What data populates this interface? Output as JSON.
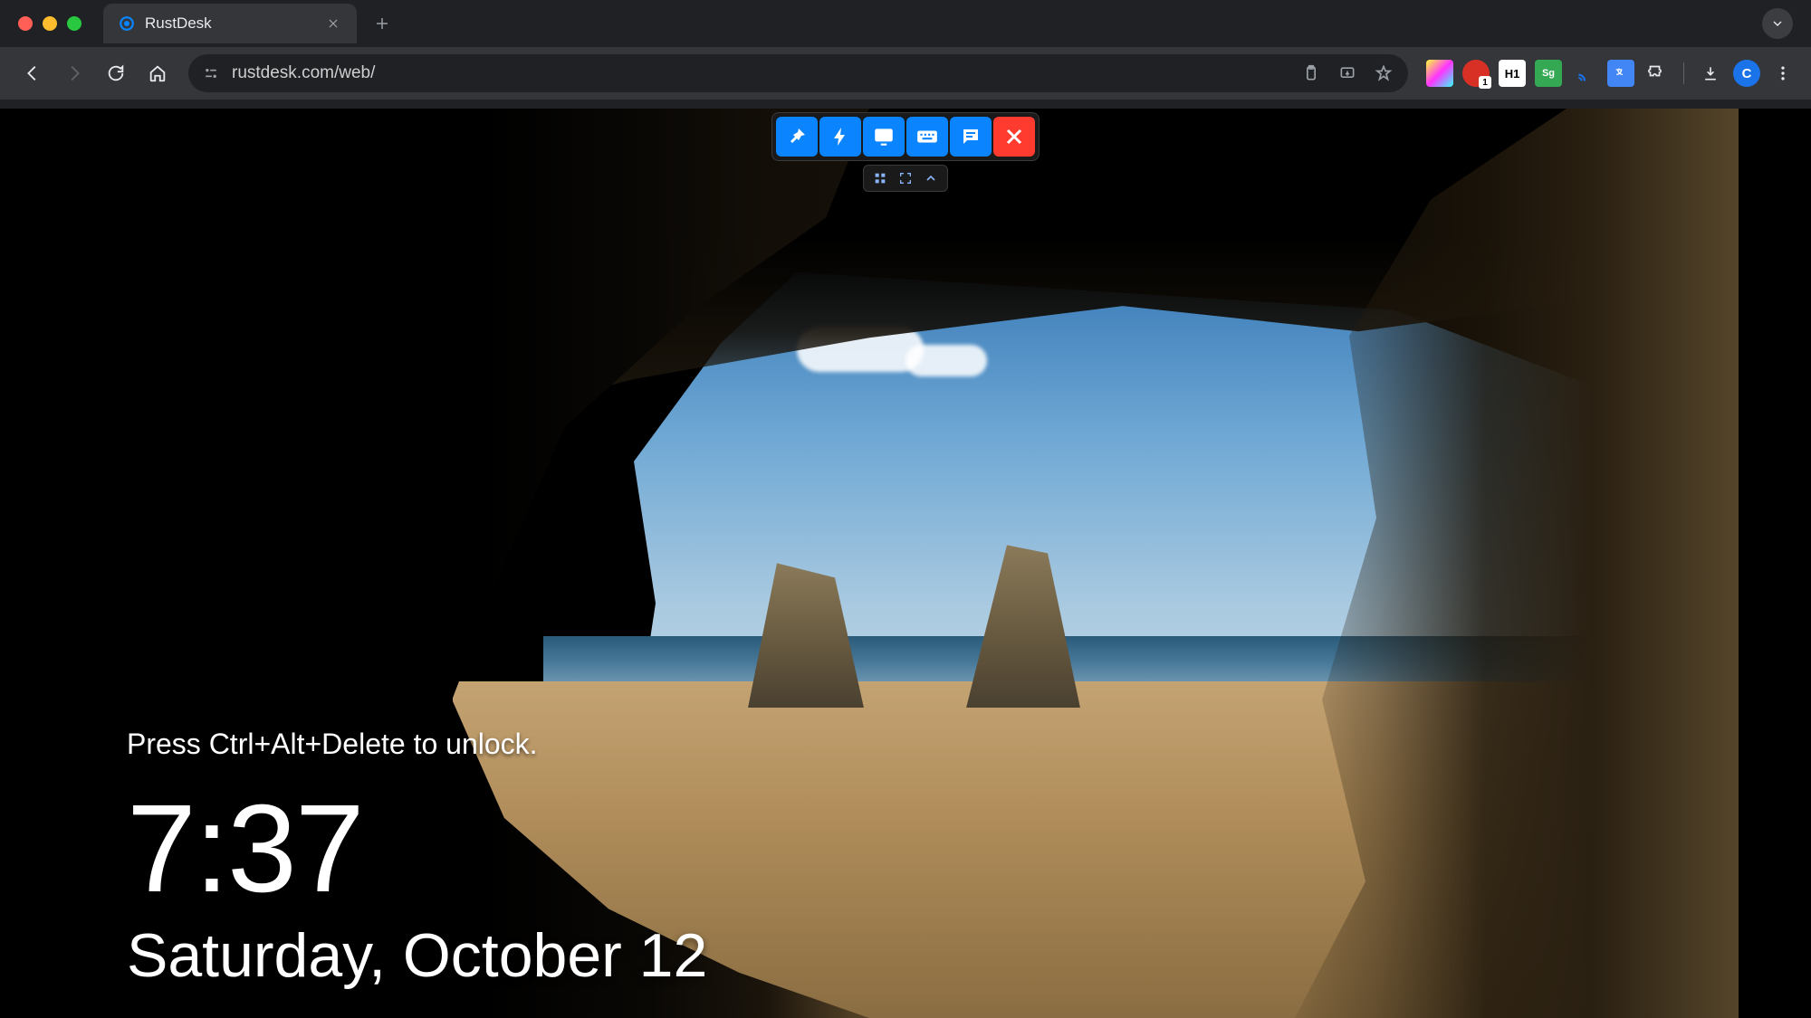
{
  "browser": {
    "tab_title": "RustDesk",
    "url": "rustdesk.com/web/",
    "profile_initial": "C",
    "extensions": {
      "h1_label": "H1",
      "sg_label": "Sg",
      "badge_1": "1"
    }
  },
  "rustdesk_toolbar": {
    "pin": "pin-icon",
    "action": "bolt-icon",
    "display": "monitor-icon",
    "keyboard": "keyboard-icon",
    "chat": "chat-icon",
    "close": "close-icon",
    "grid": "grid-icon",
    "fullscreen": "fullscreen-icon",
    "collapse": "chevron-up-icon"
  },
  "lockscreen": {
    "hint": "Press Ctrl+Alt+Delete to unlock.",
    "time": "7:37",
    "date": "Saturday, October 12"
  }
}
